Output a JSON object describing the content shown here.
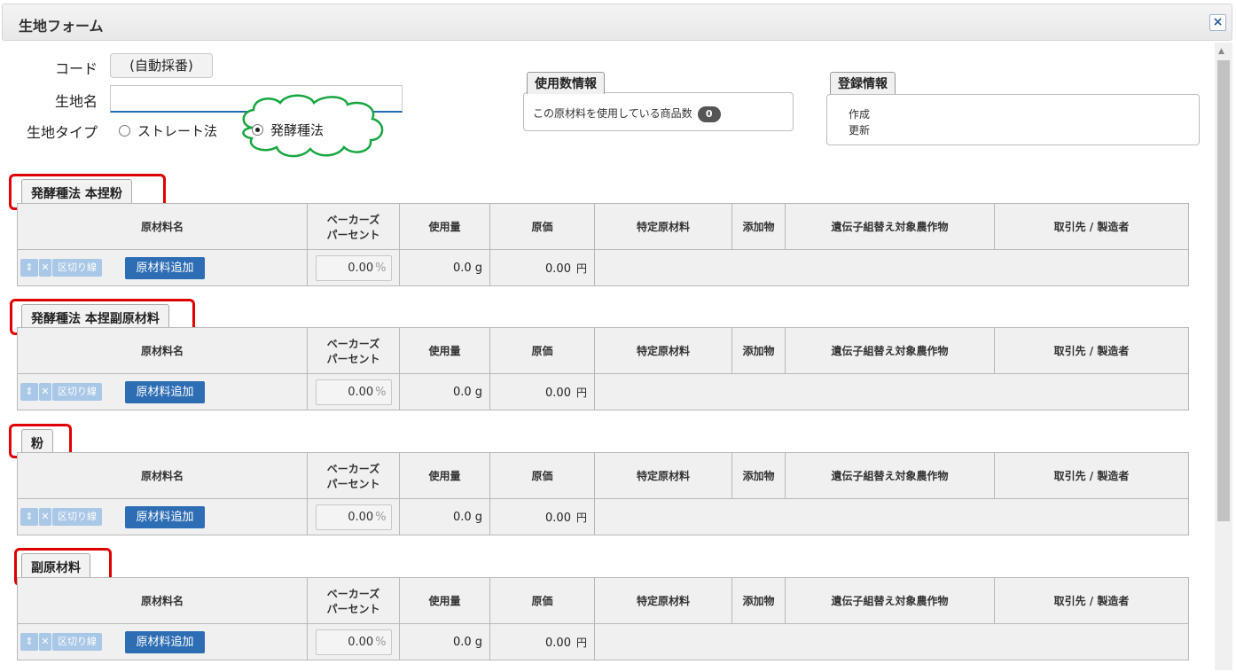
{
  "dialog": {
    "title": "生地フォーム",
    "close_icon": "×"
  },
  "form": {
    "code_label": "コード",
    "code_value": "(自動採番)",
    "name_label": "生地名",
    "name_value": "",
    "type_label": "生地タイプ",
    "type_options": [
      {
        "label": "ストレート法",
        "checked": false
      },
      {
        "label": "発酵種法",
        "checked": true
      }
    ]
  },
  "usage_info": {
    "tab": "使用数情報",
    "text": "この原材料を使用している商品数",
    "count": "0"
  },
  "registration_info": {
    "tab": "登録情報",
    "created": "作成",
    "updated": "更新"
  },
  "columns": [
    "原材料名",
    "ベーカーズ",
    "パーセント",
    "使用量",
    "原価",
    "特定原材料",
    "添加物",
    "遺伝子組替え対象農作物",
    "取引先 / 製造者"
  ],
  "row_defaults": {
    "separator": "区切り線",
    "add_button": "原材料追加",
    "percent": "0.00",
    "percent_unit": "%",
    "usage": "0.0 g",
    "cost": "0.00",
    "yen": "円"
  },
  "sections": [
    {
      "title": "発酵種法 本捏粉"
    },
    {
      "title": "発酵種法 本捏副原材料"
    },
    {
      "title": "粉"
    },
    {
      "title": "副原材料"
    }
  ],
  "colors": {
    "highlight": "#e00000",
    "cloud": "#17a640",
    "button": "#2d6db4"
  }
}
